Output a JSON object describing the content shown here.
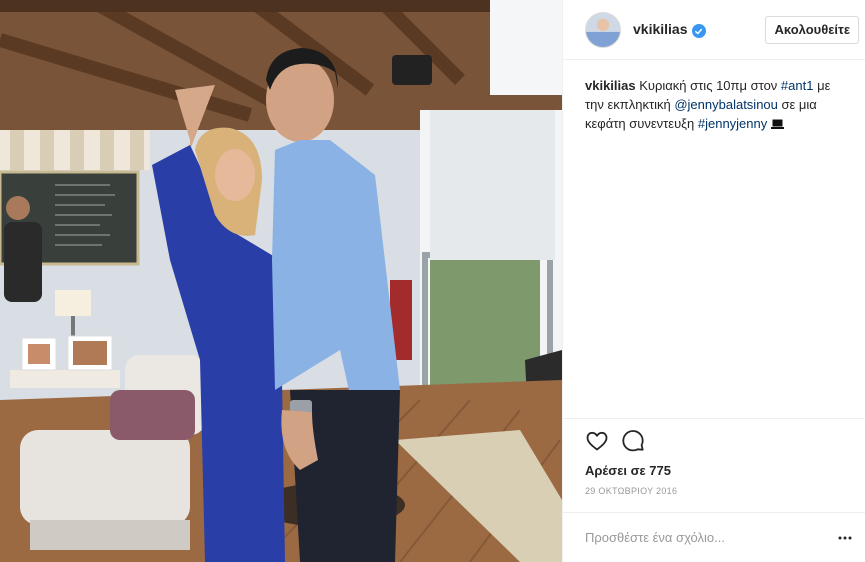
{
  "post": {
    "author": {
      "username": "vkikilias",
      "verified": true,
      "follow_label": "Ακολουθείτε"
    },
    "caption": {
      "username": "vkikilias",
      "text_1": " Κυριακή στις 10πμ στον ",
      "tag_ant1": "#ant1",
      "text_2": " με την εκπληκτική ",
      "mention": "@jennybalatsinou",
      "text_3": " σε μια κεφάτη συνεντευξη ",
      "hashtag": "#jennyjenny"
    },
    "actions": {
      "like_icon": "heart-icon",
      "comment_icon": "comment-bubble-icon"
    },
    "likes_text": "Αρέσει σε 775",
    "date": "29 ΟΚΤΩΒΡΙΟΥ 2016",
    "comment_placeholder": "Προσθέστε ένα σχόλιο...",
    "options_icon": "more-dots-icon"
  },
  "colors": {
    "verified": "#3897f0",
    "link": "#003569",
    "muted": "#999999",
    "divider": "#efefef"
  }
}
